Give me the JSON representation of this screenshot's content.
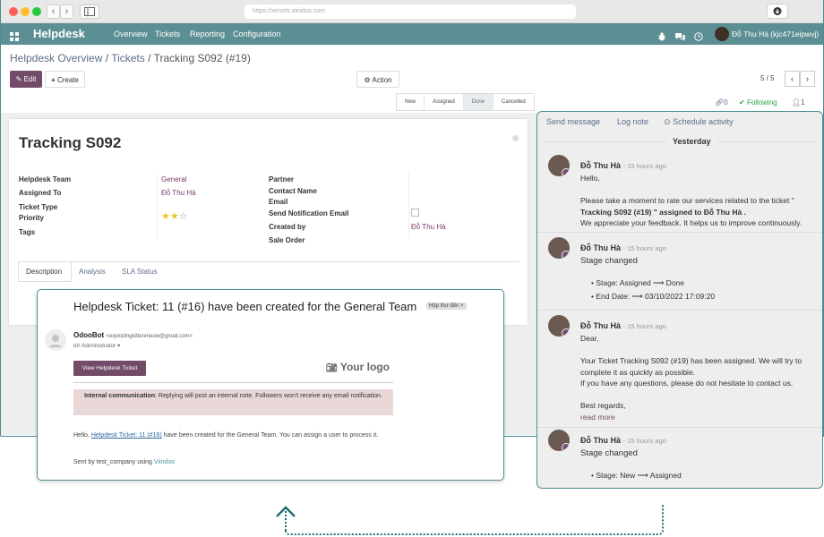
{
  "browser": {
    "url": "https://xenots.viindoo.com"
  },
  "topnav": {
    "app_title": "Helpdesk",
    "menu": [
      "Overview",
      "Tickets",
      "Reporting",
      "Configuration"
    ],
    "user_name": "Đỗ Thu Hà (kjc471eipwvj)"
  },
  "breadcrumb": {
    "item1": "Helpdesk Overview",
    "sep": "/",
    "item2": "Tickets",
    "current": "Tracking S092 (#19)"
  },
  "toolbar": {
    "edit": "Edit",
    "create": "Create",
    "action": "Action",
    "pager": "5 / 5"
  },
  "stages": [
    "New",
    "Assigned",
    "Done",
    "Cancelled"
  ],
  "chatter_topbar": {
    "attachments": "0",
    "following": "Following",
    "followers": "1"
  },
  "form": {
    "title": "Tracking S092",
    "labels_left": [
      "Helpdesk Team",
      "Assigned To",
      "Ticket Type",
      "Priority",
      "Tags"
    ],
    "values_left": {
      "team": "General",
      "assigned": "Đỗ Thu Hà"
    },
    "labels_right": [
      "Partner",
      "Contact Name",
      "Email",
      "Send Notification Email",
      "Created by",
      "Sale Order"
    ],
    "values_right": {
      "created_by": "Đỗ Thu Hà"
    },
    "priority_stars": 2,
    "tabs": [
      "Description",
      "Analysis",
      "SLA Status"
    ]
  },
  "chatter": {
    "send_message": "Send message",
    "log_note": "Log note",
    "schedule_activity": "Schedule activity",
    "date_separator": "Yesterday",
    "messages": [
      {
        "author": "Đỗ Thu Hà",
        "time": "- 15 hours ago",
        "lines": [
          "Hello,",
          "",
          "Please take a moment to rate our services related to the ticket \"",
          "Tracking S092 (#19) \" assigned to Đỗ Thu Hà .",
          "We appreciate your feedback. It helps us to improve continuously."
        ]
      },
      {
        "author": "Đỗ Thu Hà",
        "time": "- 15 hours ago",
        "title": "Stage changed",
        "bullets": [
          "Stage: Assigned ⟶ Done",
          "End Date: ⟶ 03/10/2022 17:09:20"
        ]
      },
      {
        "author": "Đỗ Thu Hà",
        "time": "- 15 hours ago",
        "lines": [
          "Dear,",
          "",
          "Your Ticket Tracking S092 (#19) has been assigned. We will try to",
          "complete it as quickly as possible.",
          "If you have any questions, please do not hesitate to contact us.",
          "",
          "Best regards,"
        ],
        "read_more": "read more"
      },
      {
        "author": "Đỗ Thu Hà",
        "time": "- 15 hours ago",
        "title": "Stage changed",
        "bullets": [
          "Stage: New ⟶ Assigned"
        ]
      }
    ]
  },
  "email": {
    "subject": "Helpdesk Ticket: 11 (#16) have been created for the General Team",
    "inbox_badge": "Hộp thư đến ×",
    "sender": "OdooBot",
    "sender_email": "<explodingkittenmeow@gmail.com>",
    "to": "tới Administrator ▾",
    "view_button": "View Helpdesk Ticket",
    "logo": "Your logo",
    "internal_bold": "Internal communication",
    "internal_text": ": Replying will post an internal note. Followers won't receive any email notification.",
    "body_prefix": "Hello, ",
    "body_link": "Helpdesk Ticket: 11 (#16)",
    "body_suffix": " have been created for the General Team. You can assign a user to process it.",
    "footer_prefix": "Sent by test_company using ",
    "footer_link": "Viindoo"
  },
  "colors": {
    "navbar": "#5c8f93",
    "primary": "#714b67",
    "frame": "#4a8c91",
    "following": "#28a745"
  }
}
